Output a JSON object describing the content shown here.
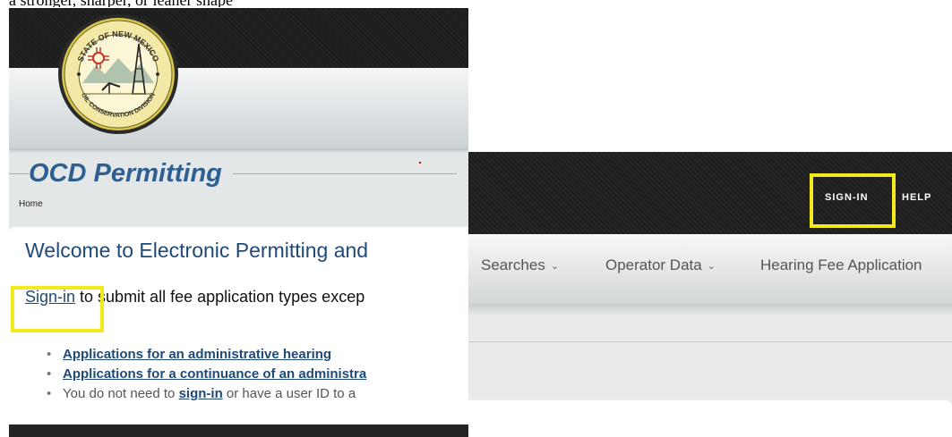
{
  "caption": "a stronger, sharper, or leaner shape",
  "left_panel": {
    "seal_text_top": "STATE OF NEW MEXICO",
    "seal_text_bottom": "OIL CONSERVATION DIVISION",
    "title": "OCD Permitting",
    "breadcrumb": "Home",
    "welcome": "Welcome to Electronic Permitting and",
    "signin_link": "Sign-in",
    "signin_rest": " to submit all fee application types excep",
    "bullets": {
      "item1": "Applications for an administrative hearing",
      "item2": "Applications for a continuance of an administra",
      "item3_prefix": "You do not need to ",
      "item3_link": "sign-in",
      "item3_suffix": " or have a user ID to a"
    }
  },
  "right_panel": {
    "top_links": {
      "signin": "SIGN-IN",
      "help": "HELP"
    },
    "nav": {
      "searches": "Searches",
      "operator_data": "Operator Data",
      "hearing_fee": "Hearing Fee Application"
    }
  },
  "colors": {
    "highlight": "#f2ea1d",
    "brand_blue": "#1f4a77",
    "title_blue": "#2f5e90",
    "dark_bar": "#232323"
  }
}
